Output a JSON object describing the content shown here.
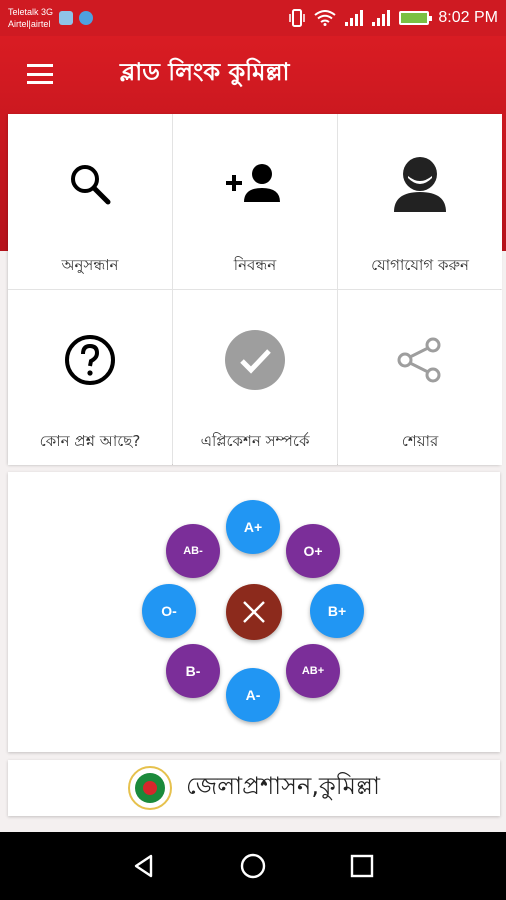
{
  "status_bar": {
    "carrier_1": "Teletalk 3G",
    "carrier_2": "Airtel|airtel",
    "time": "8:02 PM"
  },
  "app": {
    "title": "ব্লাড লিংক কুমিল্লা",
    "menu_icon": "menu-icon"
  },
  "grid": [
    {
      "label": "অনুসন্ধান",
      "icon": "search-icon"
    },
    {
      "label": "নিবন্ধন",
      "icon": "add-person-icon"
    },
    {
      "label": "যোগাযোগ করুন",
      "icon": "contact-avatar-icon"
    },
    {
      "label": "কোন প্রশ্ন আছে?",
      "icon": "help-circle-icon"
    },
    {
      "label": "এপ্লিকেশন সম্পর্কে",
      "icon": "check-circle-icon"
    },
    {
      "label": "শেয়ার",
      "icon": "share-icon"
    }
  ],
  "blood_groups": {
    "a_pos": "A+",
    "o_pos": "O+",
    "b_pos": "B+",
    "ab_pos": "AB+",
    "a_neg": "A-",
    "b_neg": "B-",
    "o_neg": "O-",
    "ab_neg": "AB-"
  },
  "footer": {
    "text": "জেলাপ্রশাসন,কুমিল্লা"
  },
  "colors": {
    "primary": "#cf1a22",
    "blue_fab": "#2196f3",
    "purple_fab": "#7b2e99",
    "close_fab": "#8c2a1c"
  }
}
